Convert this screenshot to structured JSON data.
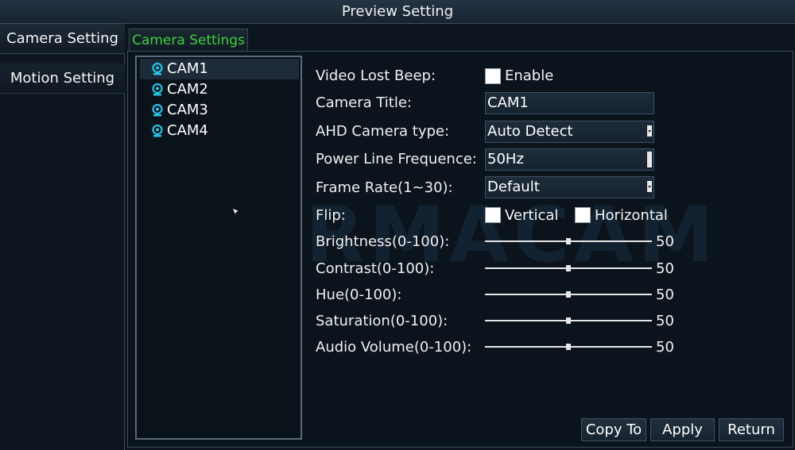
{
  "window": {
    "title": "Preview Setting"
  },
  "sidebar": {
    "items": [
      {
        "label": "Camera Setting",
        "active": true
      },
      {
        "label": "Motion Setting",
        "active": false
      }
    ]
  },
  "subtab": {
    "label": "Camera Settings"
  },
  "watermark": "PORMACAM",
  "cameras": [
    "CAM1",
    "CAM2",
    "CAM3",
    "CAM4"
  ],
  "selected_camera": "CAM1",
  "settings": {
    "video_lost_beep": {
      "label": "Video Lost Beep:",
      "option": "Enable",
      "checked": false
    },
    "camera_title": {
      "label": "Camera Title:",
      "value": "CAM1"
    },
    "ahd_type": {
      "label": "AHD Camera type:",
      "value": "Auto Detect"
    },
    "power_line": {
      "label": "Power Line Frequence:",
      "value": "50Hz"
    },
    "frame_rate": {
      "label": "Frame Rate(1~30):",
      "value": "Default"
    },
    "flip": {
      "label": "Flip:",
      "vertical": "Vertical",
      "horizontal": "Horizontal",
      "vertical_checked": false,
      "horizontal_checked": false
    },
    "brightness": {
      "label": "Brightness(0-100):",
      "value": 50
    },
    "contrast": {
      "label": "Contrast(0-100):",
      "value": 50
    },
    "hue": {
      "label": "Hue(0-100):",
      "value": 50
    },
    "saturation": {
      "label": "Saturation(0-100):",
      "value": 50
    },
    "audio_volume": {
      "label": "Audio Volume(0-100):",
      "value": 50
    }
  },
  "buttons": {
    "copy_to": "Copy To",
    "apply": "Apply",
    "return": "Return"
  },
  "colors": {
    "accent_green": "#3fcf3f",
    "icon_cyan": "#29c3e6",
    "background": "#0d1620"
  },
  "icons": {
    "camera": "webcam-icon",
    "cursor": "mouse-pointer-icon"
  }
}
